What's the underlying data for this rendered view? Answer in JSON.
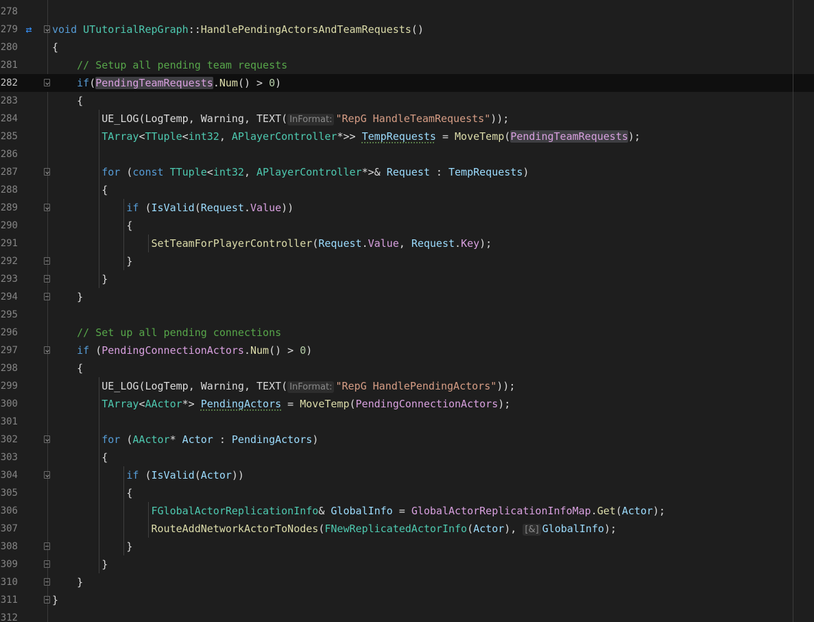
{
  "editor": {
    "current_line": "282",
    "lines": [
      {
        "num": "278",
        "fold": "",
        "tokens": []
      },
      {
        "num": "279",
        "fold": "open",
        "marker": "method-link-icon",
        "tokens": [
          {
            "t": "void",
            "c": "kw"
          },
          {
            "t": " "
          },
          {
            "t": "UTutorialRepGraph",
            "c": "ty"
          },
          {
            "t": "::"
          },
          {
            "t": "HandlePendingActorsAndTeamRequests",
            "c": "fn"
          },
          {
            "t": "()"
          }
        ]
      },
      {
        "num": "280",
        "fold": "",
        "tokens": [
          {
            "t": "{"
          }
        ]
      },
      {
        "num": "281",
        "fold": "",
        "tokens": [
          {
            "t": "    "
          },
          {
            "t": "// Setup all pending team requests",
            "c": "cm"
          }
        ]
      },
      {
        "num": "282",
        "fold": "open",
        "tokens": [
          {
            "t": "    "
          },
          {
            "t": "if",
            "c": "kw"
          },
          {
            "t": "("
          },
          {
            "t": "PendingTeamRequests",
            "c": "mb",
            "hl": true
          },
          {
            "t": "."
          },
          {
            "t": "Num",
            "c": "fn"
          },
          {
            "t": "() > "
          },
          {
            "t": "0",
            "c": "nu"
          },
          {
            "t": ")"
          }
        ]
      },
      {
        "num": "283",
        "fold": "",
        "tokens": [
          {
            "t": "    {"
          }
        ]
      },
      {
        "num": "284",
        "fold": "",
        "tokens": [
          {
            "t": "        "
          },
          {
            "t": "UE_LOG",
            "c": "pl"
          },
          {
            "t": "("
          },
          {
            "t": "LogTemp",
            "c": "pl"
          },
          {
            "t": ", "
          },
          {
            "t": "Warning",
            "c": "pl"
          },
          {
            "t": ", "
          },
          {
            "t": "TEXT",
            "c": "pl"
          },
          {
            "t": "("
          },
          {
            "t": "InFormat:",
            "hint": true
          },
          {
            "t": "\"RepG HandleTeamRequests\"",
            "c": "st"
          },
          {
            "t": "));"
          }
        ]
      },
      {
        "num": "285",
        "fold": "",
        "tokens": [
          {
            "t": "        "
          },
          {
            "t": "TArray",
            "c": "ty"
          },
          {
            "t": "<"
          },
          {
            "t": "TTuple",
            "c": "ty"
          },
          {
            "t": "<"
          },
          {
            "t": "int32",
            "c": "ty"
          },
          {
            "t": ", "
          },
          {
            "t": "APlayerController",
            "c": "ty"
          },
          {
            "t": "*>> "
          },
          {
            "t": "TempRequests",
            "c": "pa",
            "squig": true
          },
          {
            "t": " = "
          },
          {
            "t": "MoveTemp",
            "c": "fn"
          },
          {
            "t": "("
          },
          {
            "t": "PendingTeamRequests",
            "c": "mb",
            "hl": true
          },
          {
            "t": ");"
          }
        ]
      },
      {
        "num": "286",
        "fold": "",
        "tokens": []
      },
      {
        "num": "287",
        "fold": "open",
        "tokens": [
          {
            "t": "        "
          },
          {
            "t": "for",
            "c": "kw"
          },
          {
            "t": " ("
          },
          {
            "t": "const",
            "c": "kw"
          },
          {
            "t": " "
          },
          {
            "t": "TTuple",
            "c": "ty"
          },
          {
            "t": "<"
          },
          {
            "t": "int32",
            "c": "ty"
          },
          {
            "t": ", "
          },
          {
            "t": "APlayerController",
            "c": "ty"
          },
          {
            "t": "*>& "
          },
          {
            "t": "Request",
            "c": "pa"
          },
          {
            "t": " : "
          },
          {
            "t": "TempRequests",
            "c": "pa"
          },
          {
            "t": ")"
          }
        ]
      },
      {
        "num": "288",
        "fold": "",
        "tokens": [
          {
            "t": "        {"
          }
        ]
      },
      {
        "num": "289",
        "fold": "open",
        "tokens": [
          {
            "t": "            "
          },
          {
            "t": "if",
            "c": "kw"
          },
          {
            "t": " ("
          },
          {
            "t": "IsValid",
            "c": "pa"
          },
          {
            "t": "("
          },
          {
            "t": "Request",
            "c": "pa"
          },
          {
            "t": "."
          },
          {
            "t": "Value",
            "c": "mb"
          },
          {
            "t": "))"
          }
        ]
      },
      {
        "num": "290",
        "fold": "",
        "tokens": [
          {
            "t": "            {"
          }
        ]
      },
      {
        "num": "291",
        "fold": "",
        "tokens": [
          {
            "t": "                "
          },
          {
            "t": "SetTeamForPlayerController",
            "c": "fn"
          },
          {
            "t": "("
          },
          {
            "t": "Request",
            "c": "pa"
          },
          {
            "t": "."
          },
          {
            "t": "Value",
            "c": "mb"
          },
          {
            "t": ", "
          },
          {
            "t": "Request",
            "c": "pa"
          },
          {
            "t": "."
          },
          {
            "t": "Key",
            "c": "mb"
          },
          {
            "t": ");"
          }
        ]
      },
      {
        "num": "292",
        "fold": "end",
        "tokens": [
          {
            "t": "            }"
          }
        ]
      },
      {
        "num": "293",
        "fold": "end",
        "tokens": [
          {
            "t": "        }"
          }
        ]
      },
      {
        "num": "294",
        "fold": "end",
        "tokens": [
          {
            "t": "    }"
          }
        ]
      },
      {
        "num": "295",
        "fold": "",
        "tokens": []
      },
      {
        "num": "296",
        "fold": "",
        "tokens": [
          {
            "t": "    "
          },
          {
            "t": "// Set up all pending connections",
            "c": "cm"
          }
        ]
      },
      {
        "num": "297",
        "fold": "open",
        "tokens": [
          {
            "t": "    "
          },
          {
            "t": "if",
            "c": "kw"
          },
          {
            "t": " ("
          },
          {
            "t": "PendingConnectionActors",
            "c": "mb"
          },
          {
            "t": "."
          },
          {
            "t": "Num",
            "c": "fn"
          },
          {
            "t": "() > "
          },
          {
            "t": "0",
            "c": "nu"
          },
          {
            "t": ")"
          }
        ]
      },
      {
        "num": "298",
        "fold": "",
        "tokens": [
          {
            "t": "    {"
          }
        ]
      },
      {
        "num": "299",
        "fold": "",
        "tokens": [
          {
            "t": "        "
          },
          {
            "t": "UE_LOG",
            "c": "pl"
          },
          {
            "t": "("
          },
          {
            "t": "LogTemp",
            "c": "pl"
          },
          {
            "t": ", "
          },
          {
            "t": "Warning",
            "c": "pl"
          },
          {
            "t": ", "
          },
          {
            "t": "TEXT",
            "c": "pl"
          },
          {
            "t": "("
          },
          {
            "t": "InFormat:",
            "hint": true
          },
          {
            "t": "\"RepG HandlePendingActors\"",
            "c": "st"
          },
          {
            "t": "));"
          }
        ]
      },
      {
        "num": "300",
        "fold": "",
        "tokens": [
          {
            "t": "        "
          },
          {
            "t": "TArray",
            "c": "ty"
          },
          {
            "t": "<"
          },
          {
            "t": "AActor",
            "c": "ty"
          },
          {
            "t": "*> "
          },
          {
            "t": "PendingActors",
            "c": "pa",
            "squig": true
          },
          {
            "t": " = "
          },
          {
            "t": "MoveTemp",
            "c": "fn"
          },
          {
            "t": "("
          },
          {
            "t": "PendingConnectionActors",
            "c": "mb"
          },
          {
            "t": ");"
          }
        ]
      },
      {
        "num": "301",
        "fold": "",
        "tokens": []
      },
      {
        "num": "302",
        "fold": "open",
        "tokens": [
          {
            "t": "        "
          },
          {
            "t": "for",
            "c": "kw"
          },
          {
            "t": " ("
          },
          {
            "t": "AActor",
            "c": "ty"
          },
          {
            "t": "* "
          },
          {
            "t": "Actor",
            "c": "pa"
          },
          {
            "t": " : "
          },
          {
            "t": "PendingActors",
            "c": "pa"
          },
          {
            "t": ")"
          }
        ]
      },
      {
        "num": "303",
        "fold": "",
        "tokens": [
          {
            "t": "        {"
          }
        ]
      },
      {
        "num": "304",
        "fold": "open",
        "tokens": [
          {
            "t": "            "
          },
          {
            "t": "if",
            "c": "kw"
          },
          {
            "t": " ("
          },
          {
            "t": "IsValid",
            "c": "pa"
          },
          {
            "t": "("
          },
          {
            "t": "Actor",
            "c": "pa"
          },
          {
            "t": "))"
          }
        ]
      },
      {
        "num": "305",
        "fold": "",
        "tokens": [
          {
            "t": "            {"
          }
        ]
      },
      {
        "num": "306",
        "fold": "",
        "tokens": [
          {
            "t": "                "
          },
          {
            "t": "FGlobalActorReplicationInfo",
            "c": "ty"
          },
          {
            "t": "& "
          },
          {
            "t": "GlobalInfo",
            "c": "pa"
          },
          {
            "t": " = "
          },
          {
            "t": "GlobalActorReplicationInfoMap",
            "c": "mb"
          },
          {
            "t": "."
          },
          {
            "t": "Get",
            "c": "fn"
          },
          {
            "t": "("
          },
          {
            "t": "Actor",
            "c": "pa"
          },
          {
            "t": ");"
          }
        ]
      },
      {
        "num": "307",
        "fold": "",
        "tokens": [
          {
            "t": "                "
          },
          {
            "t": "RouteAddNetworkActorToNodes",
            "c": "fn"
          },
          {
            "t": "("
          },
          {
            "t": "FNewReplicatedActorInfo",
            "c": "ty"
          },
          {
            "t": "("
          },
          {
            "t": "Actor",
            "c": "pa"
          },
          {
            "t": "), "
          },
          {
            "t": "[&]",
            "hint": true
          },
          {
            "t": "GlobalInfo",
            "c": "pa"
          },
          {
            "t": ");"
          }
        ]
      },
      {
        "num": "308",
        "fold": "end",
        "tokens": [
          {
            "t": "            }"
          }
        ]
      },
      {
        "num": "309",
        "fold": "end",
        "tokens": [
          {
            "t": "        }"
          }
        ]
      },
      {
        "num": "310",
        "fold": "end",
        "tokens": [
          {
            "t": "    }"
          }
        ]
      },
      {
        "num": "311",
        "fold": "end",
        "tokens": [
          {
            "t": "}"
          }
        ]
      },
      {
        "num": "312",
        "fold": "",
        "tokens": []
      }
    ]
  }
}
